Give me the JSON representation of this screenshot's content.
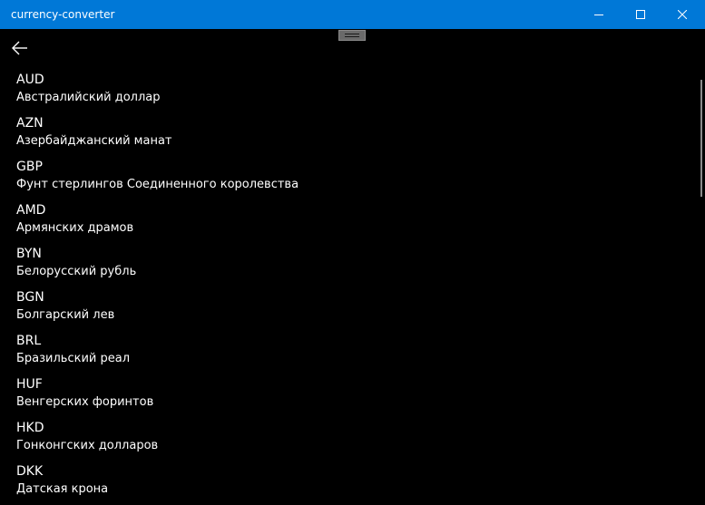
{
  "window": {
    "title": "currency-converter",
    "accent_color": "#0078d7",
    "background_color": "#000000"
  },
  "caption_buttons": {
    "minimize_icon": "minimize-icon",
    "maximize_icon": "maximize-icon",
    "close_icon": "close-icon"
  },
  "header": {
    "back_icon": "arrow-left-icon"
  },
  "currencies": [
    {
      "code": "AUD",
      "name": "Австралийский доллар"
    },
    {
      "code": "AZN",
      "name": "Азербайджанский манат"
    },
    {
      "code": "GBP",
      "name": "Фунт стерлингов Соединенного королевства"
    },
    {
      "code": "AMD",
      "name": "Армянских драмов"
    },
    {
      "code": "BYN",
      "name": "Белорусский рубль"
    },
    {
      "code": "BGN",
      "name": "Болгарский лев"
    },
    {
      "code": "BRL",
      "name": "Бразильский реал"
    },
    {
      "code": "HUF",
      "name": "Венгерских форинтов"
    },
    {
      "code": "HKD",
      "name": "Гонконгских долларов"
    },
    {
      "code": "DKK",
      "name": "Датская крона"
    }
  ]
}
